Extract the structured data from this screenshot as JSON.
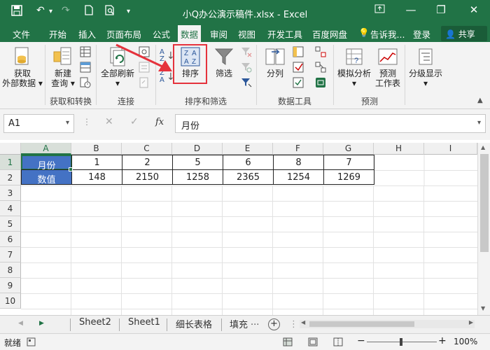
{
  "titlebar": {
    "title": "小Q办公演示稿件.xlsx - Excel",
    "minimize": "—",
    "restore": "❐",
    "close": "✕"
  },
  "menu": {
    "items": [
      "文件",
      "开始",
      "插入",
      "页面布局",
      "公式",
      "数据",
      "审阅",
      "视图",
      "开发工具",
      "百度网盘"
    ],
    "active": "数据",
    "tellme": "告诉我...",
    "login": "登录",
    "share": "共享"
  },
  "ribbon": {
    "get_data_1": "获取",
    "get_data_2": "外部数据",
    "new_query_1": "新建",
    "new_query_2": "查询",
    "refresh_all": "全部刷新",
    "sort": "排序",
    "filter": "筛选",
    "text_to_columns": "分列",
    "what_if_1": "模拟分析",
    "forecast_1": "预测",
    "forecast_2": "工作表",
    "outline": "分级显示",
    "groups": {
      "get_transform": "获取和转换",
      "connections": "连接",
      "sort_filter": "排序和筛选",
      "data_tools": "数据工具",
      "forecast": "预测"
    },
    "sort_az_1": "A",
    "sort_az_2": "Z",
    "sort_za_1": "Z",
    "sort_za_2": "A"
  },
  "formula_bar": {
    "name_box": "A1",
    "fx": "fx",
    "content": "月份"
  },
  "grid": {
    "columns": [
      "A",
      "B",
      "C",
      "D",
      "E",
      "F",
      "G",
      "H",
      "I"
    ],
    "rows": [
      "1",
      "2",
      "3",
      "4",
      "5",
      "6",
      "7",
      "8",
      "9",
      "10"
    ],
    "row1": [
      "月份",
      "1",
      "2",
      "5",
      "6",
      "8",
      "7"
    ],
    "row2": [
      "数值",
      "148",
      "2150",
      "1258",
      "2365",
      "1254",
      "1269"
    ]
  },
  "sheets": {
    "tabs": [
      "Sheet2",
      "Sheet1",
      "细长表格",
      "填充"
    ],
    "more": "...",
    "add": "+"
  },
  "status": {
    "ready": "就绪",
    "zoom": "100%",
    "minus": "−",
    "plus": "+"
  },
  "colors": {
    "excel_green": "#217346",
    "header_blue": "#4472c4",
    "highlight_red": "#e5323c"
  }
}
